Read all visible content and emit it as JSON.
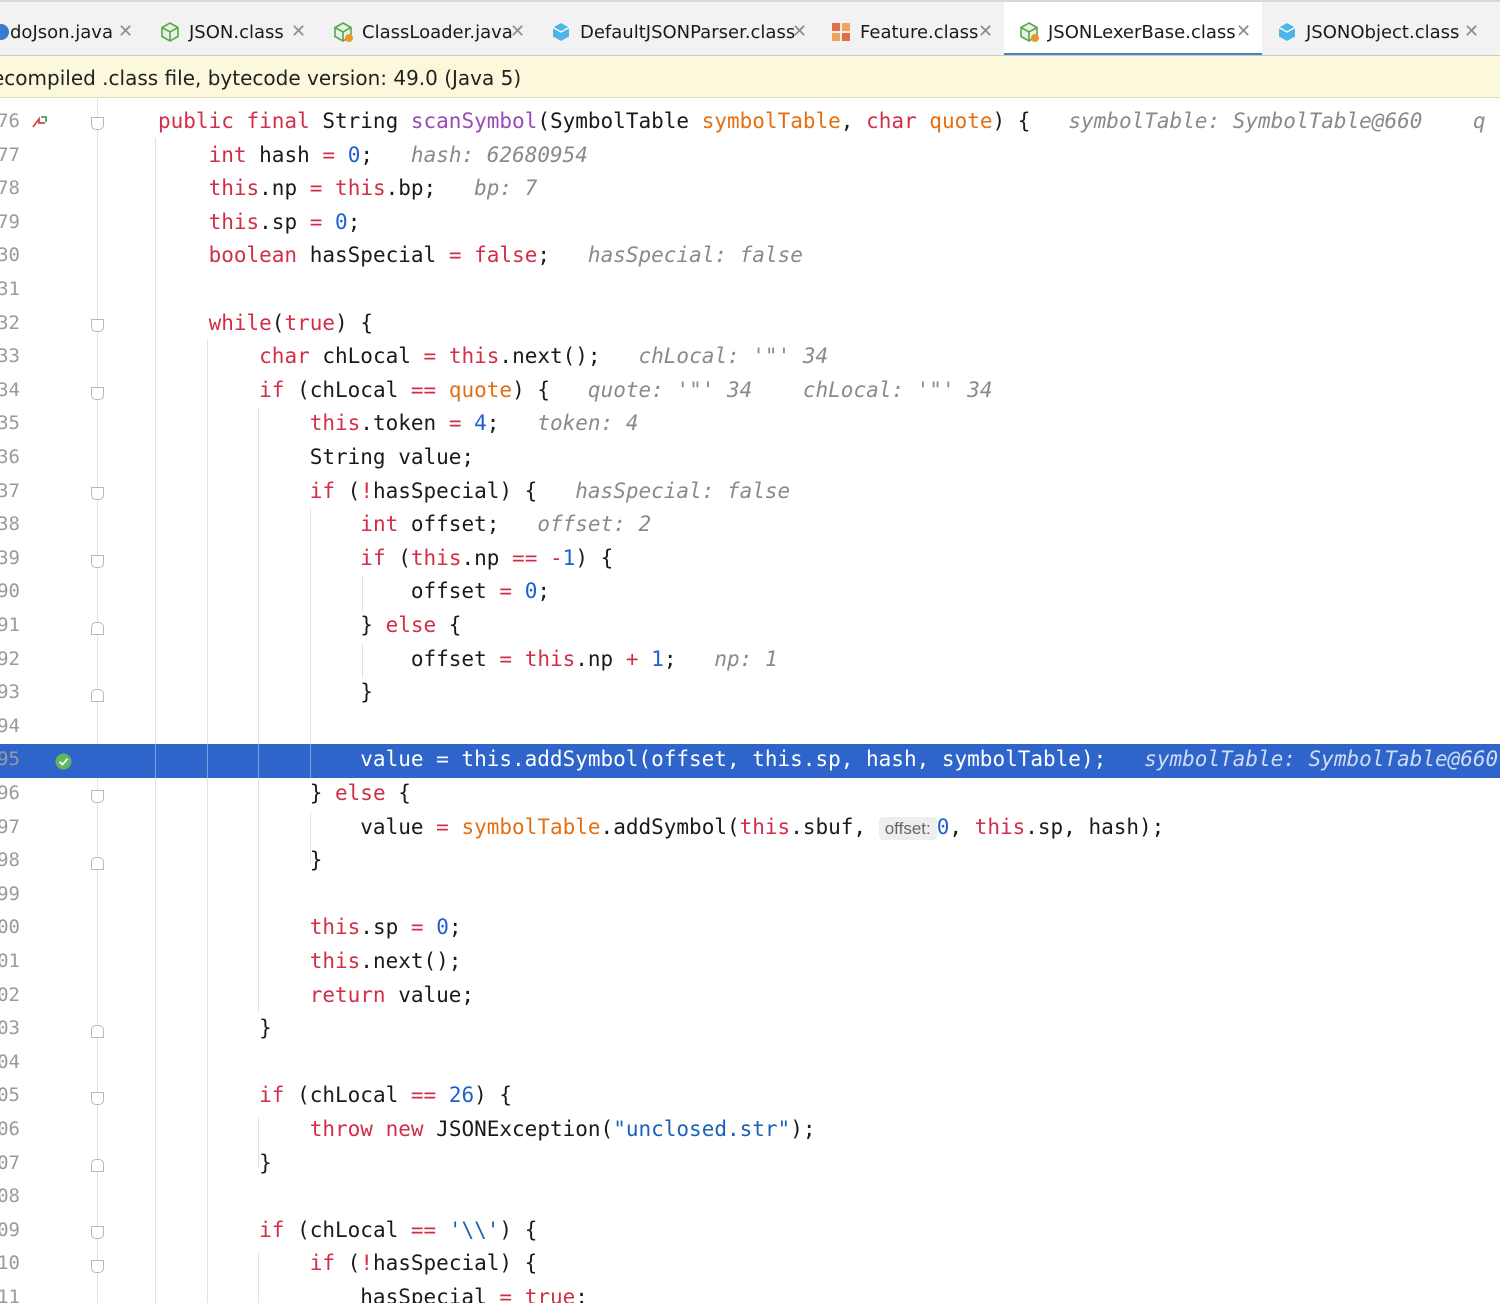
{
  "tabs": [
    {
      "label": "doJson.java",
      "icon": "java-file-icon",
      "active": false
    },
    {
      "label": "JSON.class",
      "icon": "class-file-icon",
      "active": false
    },
    {
      "label": "ClassLoader.java",
      "icon": "class-file-icon",
      "active": false
    },
    {
      "label": "DefaultJSONParser.class",
      "icon": "interface-file-icon",
      "active": false
    },
    {
      "label": "Feature.class",
      "icon": "enum-file-icon",
      "active": false
    },
    {
      "label": "JSONLexerBase.class",
      "icon": "class-file-icon",
      "active": true
    },
    {
      "label": "JSONObject.class",
      "icon": "interface-file-icon",
      "active": false
    }
  ],
  "banner": {
    "text": "ecompiled .class file, bytecode version: 49.0 (Java 5)"
  },
  "colors": {
    "keyword": "#d22e47",
    "parameter": "#e36f12",
    "method": "#9a49b8",
    "number": "#1f5fd1",
    "current_line": "#2f65ca",
    "tab_underline": "#4083c9",
    "banner_bg": "#fcf8dc",
    "breakpoint_check": "#5fb85f"
  },
  "gutter": {
    "line_numbers": [
      "76",
      "77",
      "78",
      "79",
      "30",
      "31",
      "32",
      "33",
      "34",
      "35",
      "36",
      "37",
      "38",
      "39",
      "90",
      "91",
      "92",
      "93",
      "94",
      "95",
      "96",
      "97",
      "98",
      "99",
      "00",
      "01",
      "02",
      "03",
      "04",
      "05",
      "06",
      "07",
      "08",
      "09",
      "10",
      "11"
    ],
    "override_marker_icon": "override-method-icon",
    "current_line_icon": "check-circle-icon"
  },
  "editor": {
    "current_line_index": 19,
    "debug_hints": {
      "l76": "symbolTable: SymbolTable@660",
      "l76_trailing": "q",
      "l77": "hash: 62680954",
      "l78": "bp: 7",
      "l80": "hasSpecial: false",
      "l83": "chLocal: '\"' 34",
      "l84a": "quote: '\"' 34",
      "l84b": "chLocal: '\"' 34",
      "l85": "token: 4",
      "l87": "hasSpecial: false",
      "l88": "offset: 2",
      "l92": "np: 1",
      "l95": "symbolTable: SymbolTable@660",
      "l97_param_badge": "offset:"
    },
    "lines": [
      "public final String scanSymbol(SymbolTable symbolTable, char quote) {",
      "int hash = 0;",
      "this.np = this.bp;",
      "this.sp = 0;",
      "boolean hasSpecial = false;",
      "",
      "while(true) {",
      "char chLocal = this.next();",
      "if (chLocal == quote) {",
      "this.token = 4;",
      "String value;",
      "if (!hasSpecial) {",
      "int offset;",
      "if (this.np == -1) {",
      "offset = 0;",
      "} else {",
      "offset = this.np + 1;",
      "}",
      "",
      "value = this.addSymbol(offset, this.sp, hash, symbolTable);",
      "} else {",
      "value = symbolTable.addSymbol(this.sbuf, 0, this.sp, hash);",
      "}",
      "",
      "this.sp = 0;",
      "this.next();",
      "return value;",
      "}",
      "",
      "if (chLocal == 26) {",
      "throw new JSONException(\"unclosed.str\");",
      "}",
      "",
      "if (chLocal == '\\\\') {",
      "if (!hasSpecial) {",
      "hasSpecial = true;"
    ]
  }
}
